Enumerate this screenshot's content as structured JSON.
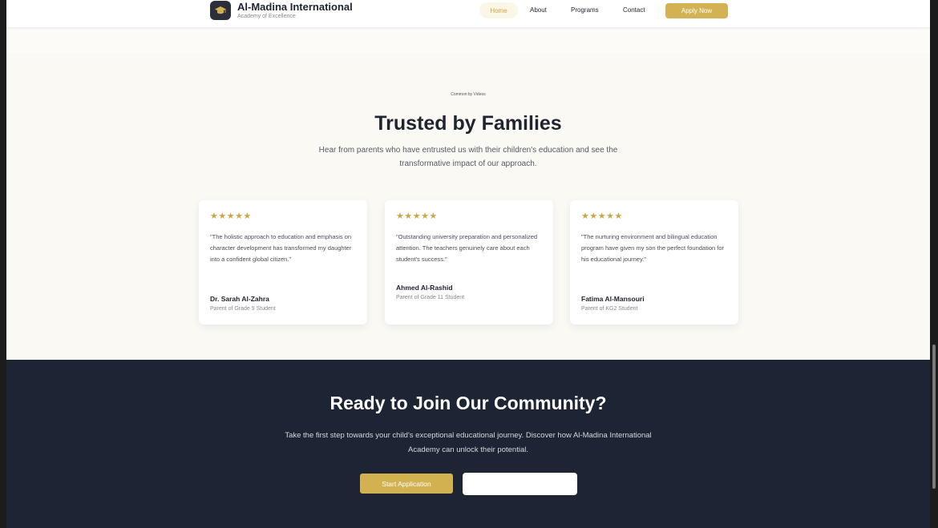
{
  "header": {
    "brand_name": "Al-Madina International",
    "brand_sub": "Academy of Excellence",
    "logo_icon": "graduation-cap-icon",
    "nav": {
      "home": "Home",
      "about": "About",
      "programs": "Programs",
      "contact": "Contact"
    },
    "apply_label": "Apply Now"
  },
  "testimonials": {
    "eyebrow": "Common by Videos",
    "title": "Trusted by Families",
    "subtitle": "Hear from parents who have entrusted us with their children's education and see the transformative impact of our approach.",
    "cards": [
      {
        "stars": "★★★★★",
        "rating": 5,
        "quote": "\"The holistic approach to education and emphasis on character development has transformed my daughter into a confident global citizen.\"",
        "author": "Dr. Sarah Al-Zahra",
        "role": "Parent of Grade 9 Student"
      },
      {
        "stars": "★★★★★",
        "rating": 5,
        "quote": "\"Outstanding university preparation and personalized attention. The teachers genuinely care about each student's success.\"",
        "author": "Ahmed Al-Rashid",
        "role": "Parent of Grade 11 Student"
      },
      {
        "stars": "★★★★★",
        "rating": 5,
        "quote": "\"The nurturing environment and bilingual education program have given my son the perfect foundation for his educational journey.\"",
        "author": "Fatima Al-Mansouri",
        "role": "Parent of KG2 Student"
      }
    ]
  },
  "cta": {
    "title": "Ready to Join Our Community?",
    "subtitle": "Take the first step towards your child's exceptional educational journey. Discover how Al-Madina International Academy can unlock their potential.",
    "start_label": "Start Application",
    "secondary_label": ""
  },
  "colors": {
    "accent": "#d4b254",
    "dark": "#1d2433",
    "text": "#1f2430"
  }
}
